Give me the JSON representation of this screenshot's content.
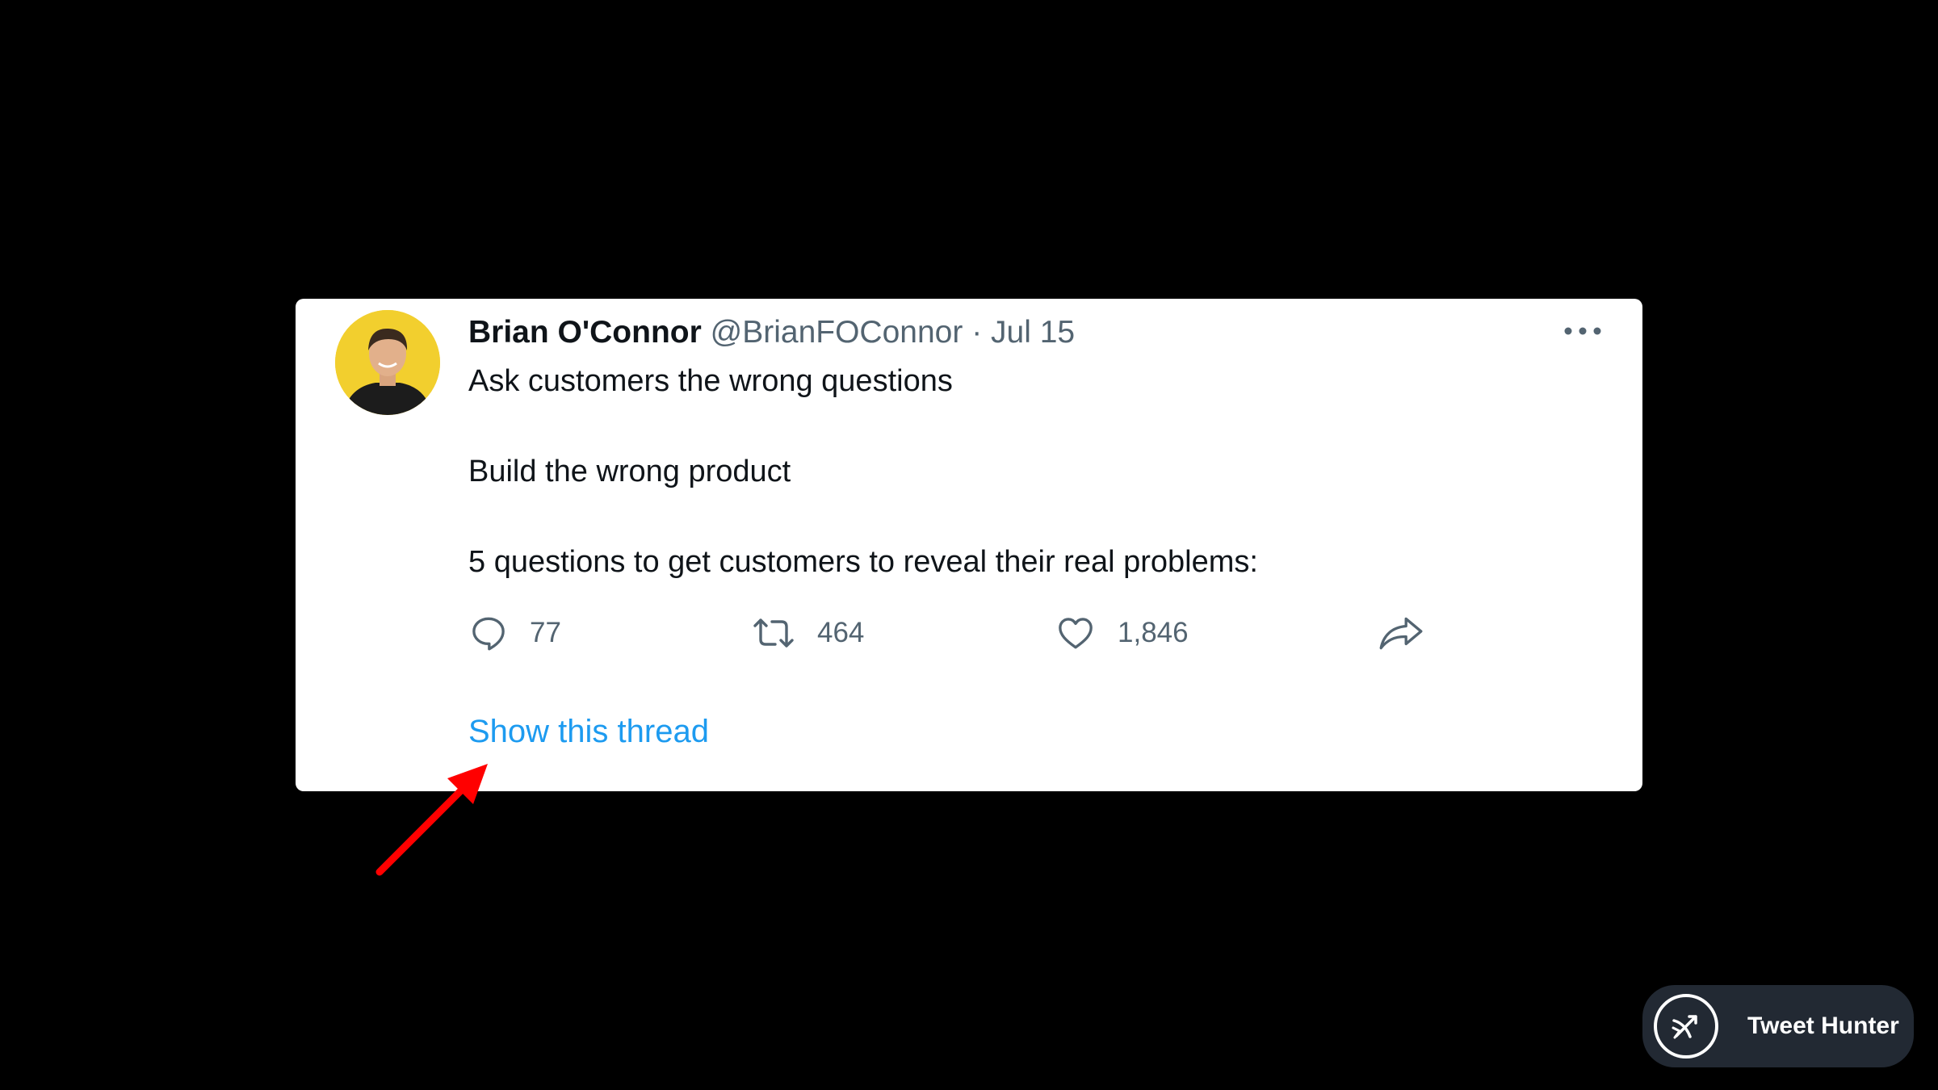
{
  "tweet": {
    "author_name": "Brian O'Connor",
    "handle": "@BrianFOConnor",
    "separator": "·",
    "date": "Jul 15",
    "text_lines": [
      "Ask customers the wrong questions",
      "Build the wrong product",
      "5 questions to get customers to reveal their real problems:"
    ],
    "actions": {
      "replies": "77",
      "retweets": "464",
      "likes": "1,846"
    },
    "show_thread_label": "Show this thread",
    "more_icon": "more-horizontal-icon"
  },
  "annotation": {
    "icon": "red-arrow-icon",
    "color": "#ff0000"
  },
  "branding": {
    "label": "Tweet Hunter",
    "icon": "tweet-hunter-logo-icon"
  },
  "colors": {
    "background": "#000000",
    "card": "#ffffff",
    "text_primary": "#0f1419",
    "text_secondary": "#536471",
    "link": "#1d9bf0",
    "avatar_bg": "#f2cf2e",
    "pill_bg": "#222933"
  }
}
